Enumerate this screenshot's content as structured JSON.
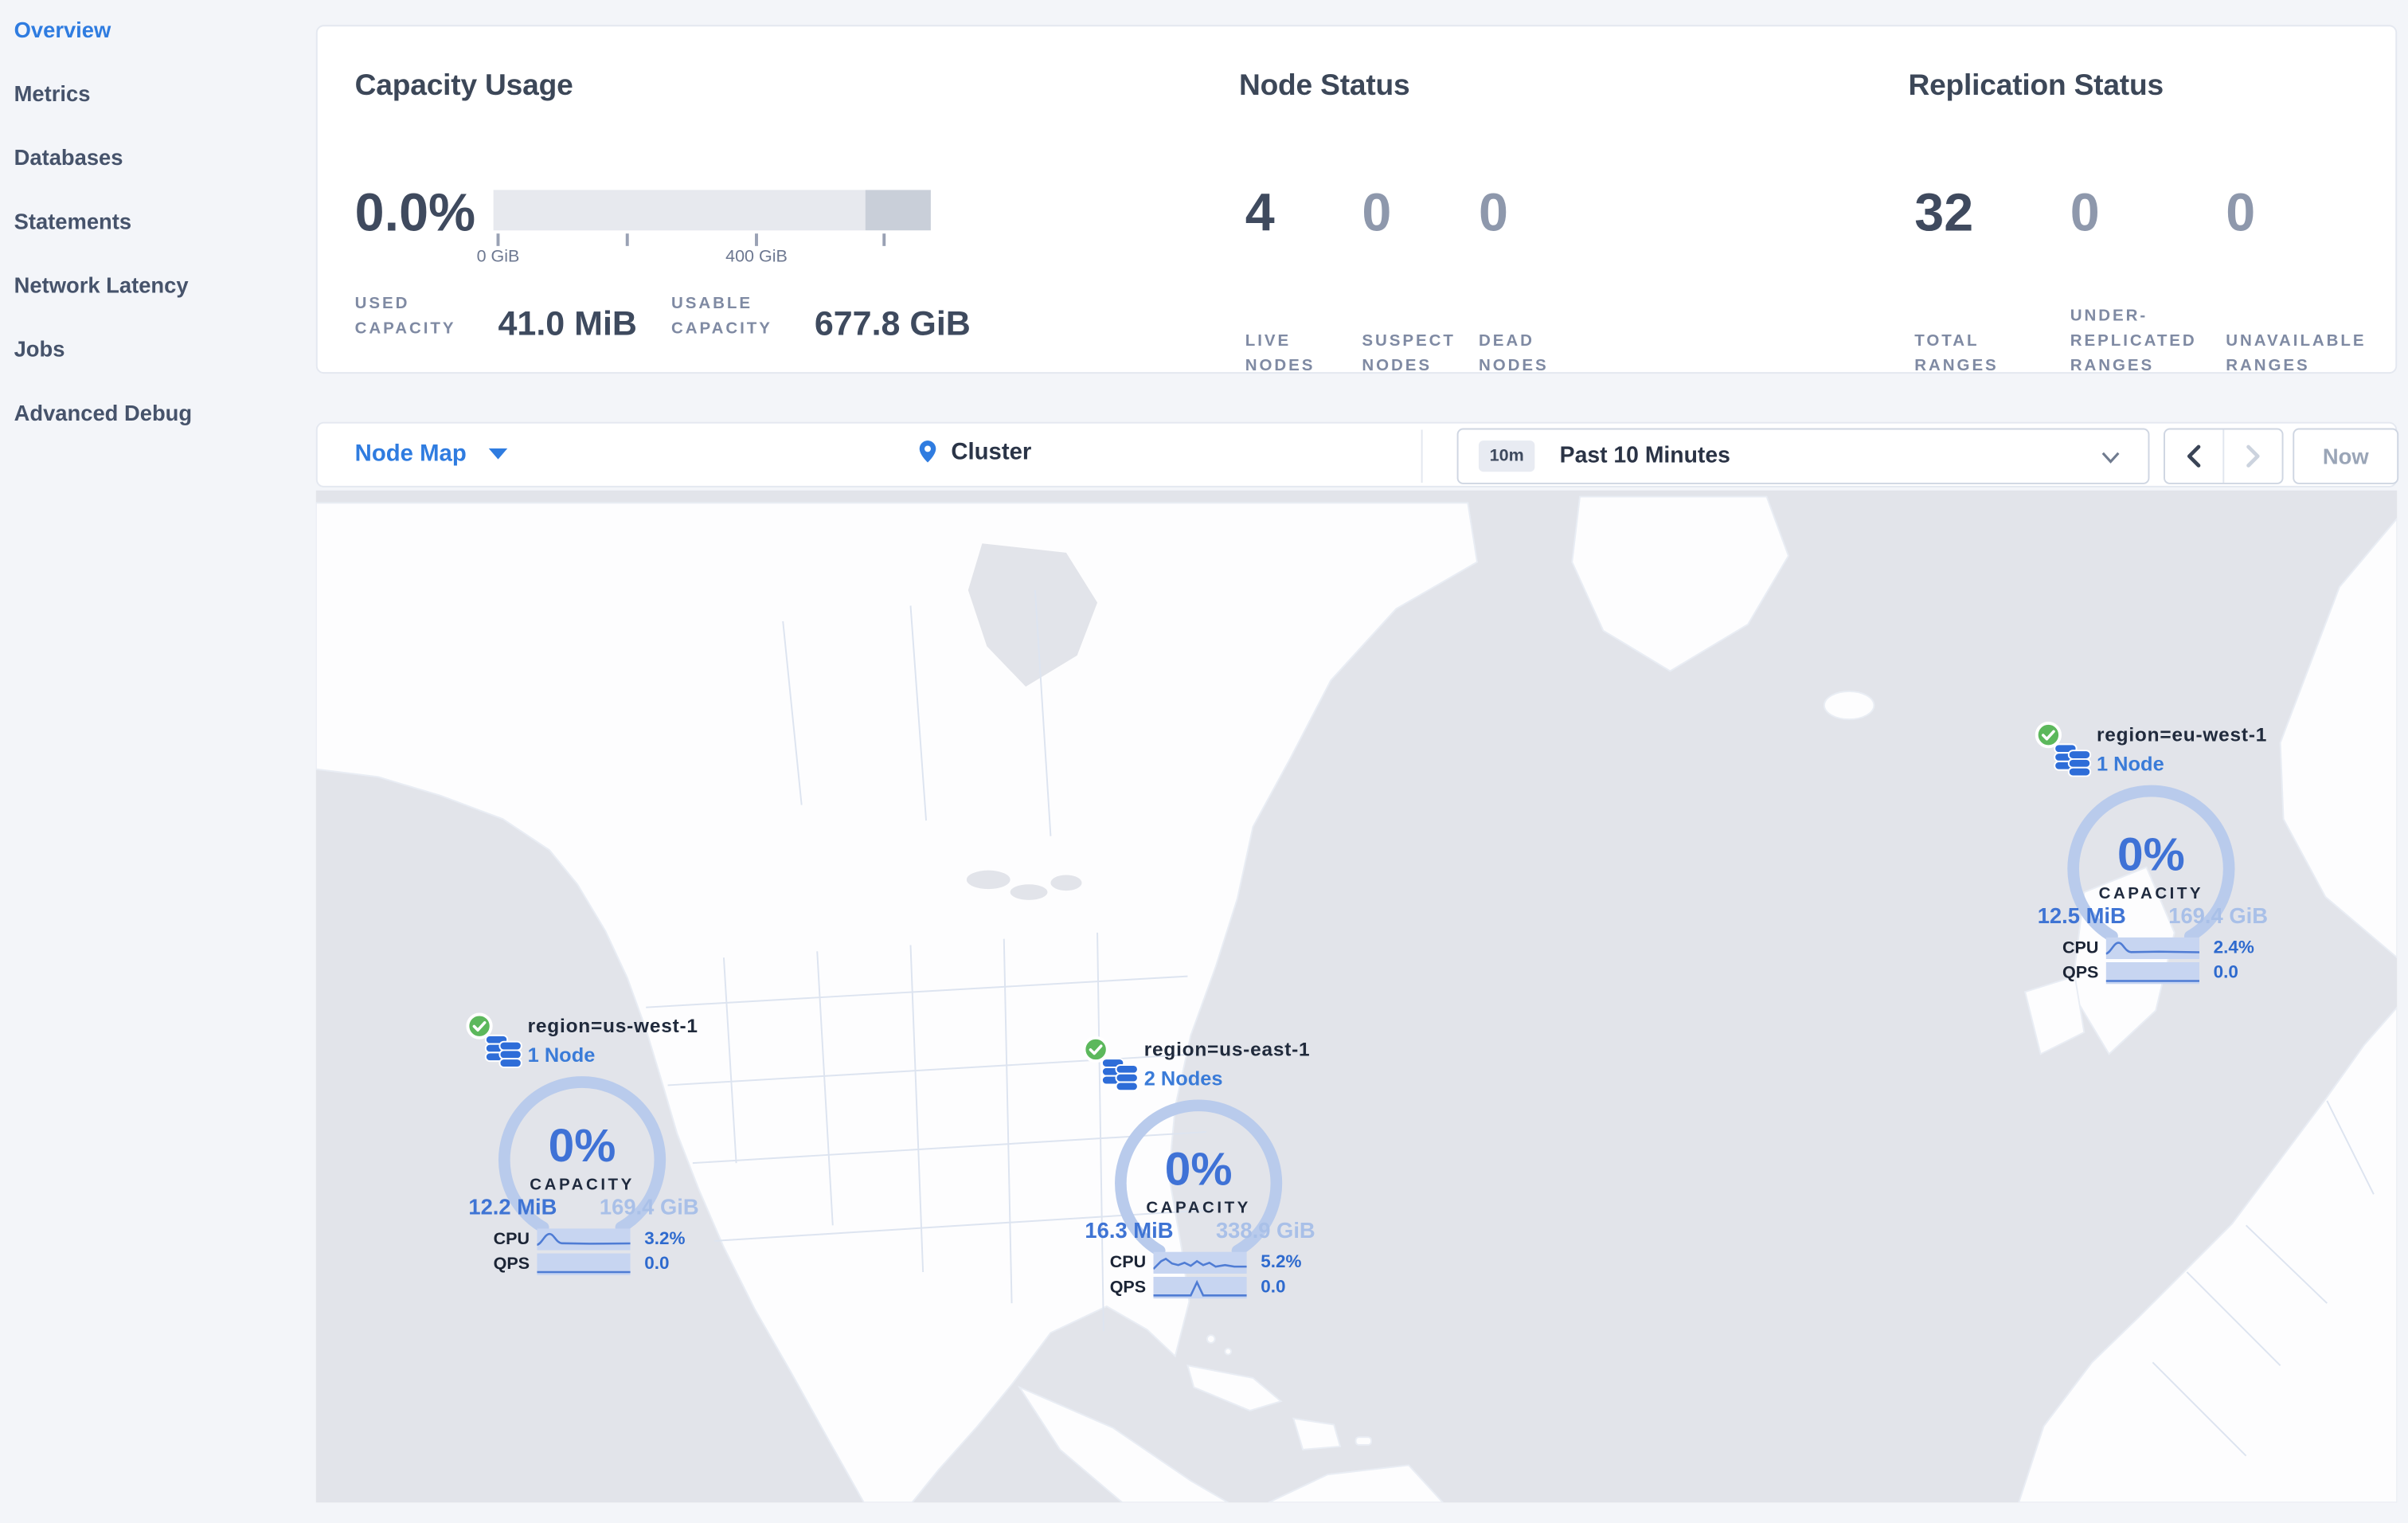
{
  "sidebar": {
    "items": [
      {
        "label": "Overview"
      },
      {
        "label": "Metrics"
      },
      {
        "label": "Databases"
      },
      {
        "label": "Statements"
      },
      {
        "label": "Network Latency"
      },
      {
        "label": "Jobs"
      },
      {
        "label": "Advanced Debug"
      }
    ]
  },
  "capacity": {
    "title": "Capacity Usage",
    "percent": "0.0%",
    "tick_labels": [
      "0 GiB",
      "400 GiB"
    ],
    "stats": [
      {
        "label": "USED CAPACITY",
        "value": "41.0 MiB"
      },
      {
        "label": "USABLE CAPACITY",
        "value": "677.8 GiB"
      }
    ]
  },
  "node_status": {
    "title": "Node Status",
    "stats": [
      {
        "value": "4",
        "label": "LIVE NODES"
      },
      {
        "value": "0",
        "label": "SUSPECT NODES"
      },
      {
        "value": "0",
        "label": "DEAD NODES"
      }
    ]
  },
  "replication": {
    "title": "Replication Status",
    "stats": [
      {
        "value": "32",
        "label": "TOTAL RANGES"
      },
      {
        "value": "0",
        "label": "UNDER-REPLICATED RANGES"
      },
      {
        "value": "0",
        "label": "UNAVAILABLE RANGES"
      }
    ]
  },
  "toolbar": {
    "view": "Node Map",
    "breadcrumb": "Cluster",
    "time_badge": "10m",
    "time_range": "Past 10 Minutes",
    "now": "Now"
  },
  "map": {
    "regions": [
      {
        "name": "region=us-west-1",
        "nodes": "1 Node",
        "pct": "0%",
        "cap_label": "CAPACITY",
        "used": "12.2 MiB",
        "usable": "169.4 GiB",
        "cpu_label": "CPU",
        "cpu": "3.2%",
        "qps_label": "QPS",
        "qps": "0.0"
      },
      {
        "name": "region=us-east-1",
        "nodes": "2 Nodes",
        "pct": "0%",
        "cap_label": "CAPACITY",
        "used": "16.3 MiB",
        "usable": "338.9 GiB",
        "cpu_label": "CPU",
        "cpu": "5.2%",
        "qps_label": "QPS",
        "qps": "0.0"
      },
      {
        "name": "region=eu-west-1",
        "nodes": "1 Node",
        "pct": "0%",
        "cap_label": "CAPACITY",
        "used": "12.5 MiB",
        "usable": "169.4 GiB",
        "cpu_label": "CPU",
        "cpu": "2.4%",
        "qps_label": "QPS",
        "qps": "0.0"
      }
    ]
  },
  "colors": {
    "accent_blue": "#2f7ce0",
    "gauge_arc": "#b9cbec",
    "gauge_text": "#3f72d6",
    "link_blue": "#3a7bd8",
    "status_green": "#5cb85c",
    "ocean": "#e2e4ea",
    "bar_light": "#e7e9ee",
    "bar_dark": "#c9cfd9"
  }
}
